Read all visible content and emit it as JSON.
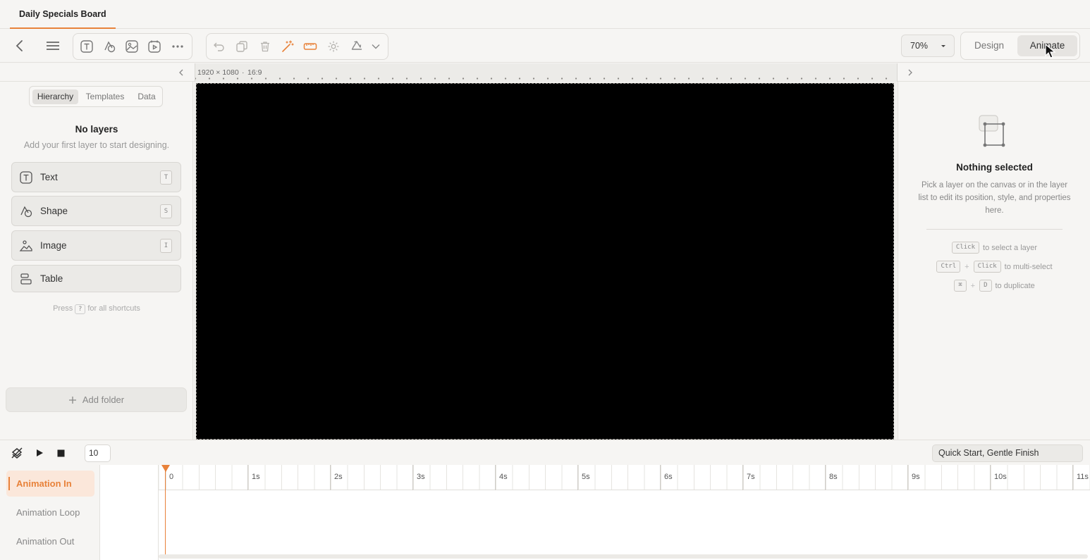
{
  "app": {
    "tab_title": "Daily Specials Board"
  },
  "toolbar": {
    "zoom": "70%",
    "mode_design": "Design",
    "mode_animate": "Animate",
    "accent": "#e8823a"
  },
  "ruler": {
    "dimensions": "1920 × 1080",
    "aspect": "16:9"
  },
  "left_panel": {
    "tabs": [
      "Hierarchy",
      "Templates",
      "Data"
    ],
    "active_tab": "Hierarchy",
    "empty_title": "No layers",
    "empty_subtitle": "Add your first layer to start designing.",
    "layer_buttons": [
      {
        "label": "Text",
        "shortcut": "T",
        "icon": "text-icon"
      },
      {
        "label": "Shape",
        "shortcut": "S",
        "icon": "shape-icon"
      },
      {
        "label": "Image",
        "shortcut": "I",
        "icon": "image-icon"
      },
      {
        "label": "Table",
        "shortcut": "",
        "icon": "table-icon"
      }
    ],
    "shortcut_hint_pre": "Press",
    "shortcut_hint_key": "?",
    "shortcut_hint_post": "for all shortcuts",
    "add_folder": "Add folder"
  },
  "right_panel": {
    "title": "Nothing selected",
    "description": "Pick a layer on the canvas or in the layer list to edit its position, style, and properties here.",
    "hints": {
      "select_key": "Click",
      "select_text": "to select a layer",
      "multi_key1": "Ctrl",
      "multi_key2": "Click",
      "multi_text": "to multi-select",
      "dup_key1": "⌘",
      "dup_key2": "D",
      "dup_text": "to duplicate",
      "plus": "+"
    }
  },
  "timeline": {
    "frames_value": "10",
    "easing": "Quick Start, Gentle Finish",
    "tracks": [
      "Animation In",
      "Animation Loop",
      "Animation Out"
    ],
    "active_track": "Animation In",
    "seconds": [
      "0",
      "1s",
      "2s",
      "3s",
      "4s",
      "5s",
      "6s",
      "7s",
      "8s",
      "9s",
      "10s",
      "11s"
    ]
  }
}
